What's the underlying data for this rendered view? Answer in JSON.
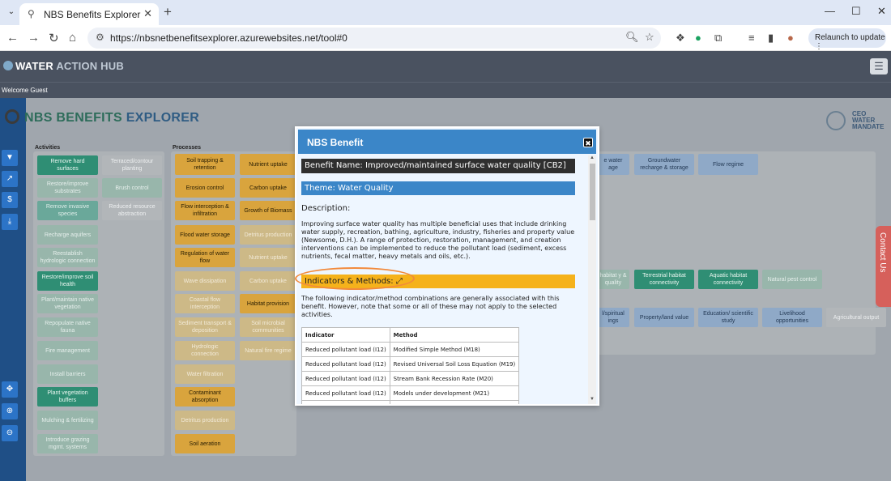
{
  "browser": {
    "tab_title": "NBS Benefits Explorer",
    "url": "https://nbsnetbenefitsexplorer.azurewebsites.net/tool#0",
    "relaunch_label": "Relaunch to update",
    "tab_close": "✕",
    "new_tab": "+",
    "minimize": "—",
    "maximize": "☐",
    "close": "✕"
  },
  "header": {
    "brand_primary": "WATER",
    "brand_secondary": "ACTION",
    "brand_tertiary": "HUB",
    "welcome": "Welcome Guest",
    "menu_icon": "☰"
  },
  "app": {
    "title_part1": "NBS BENEFITS",
    "title_part2": "EXPLORER",
    "ceo_line1": "CEO",
    "ceo_line2": "WATER",
    "ceo_line3": "MANDATE",
    "contact_label": "Contact Us"
  },
  "sidebar": {
    "icons": [
      "filter-icon",
      "chart-icon",
      "dollar-icon",
      "download-icon",
      "expand-icon",
      "zoom-in-icon",
      "zoom-out-icon"
    ]
  },
  "activities": {
    "label": "Activities",
    "items": [
      "Remove hard surfaces",
      "Terraced/contour planting",
      "Restore/improve substrates",
      "Brush control",
      "Remove invasive species",
      "Reduced resource abstraction",
      "Recharge aquifers",
      "Reestablish hydrologic connection",
      "Restore/improve soil health",
      "Plant/maintain native vegetation",
      "Repopulate native fauna",
      "Fire management",
      "Install barriers",
      "Plant vegetation buffers",
      "Mulching & fertilizing",
      "Introduce grazing mgmt. systems"
    ]
  },
  "processes": {
    "label": "Processes",
    "items": [
      "Soil trapping & retention",
      "Nutrient uptake",
      "Erosion control",
      "Carbon uptake",
      "Flow interception & infiltration",
      "Growth of Biomass",
      "Flood water storage",
      "Detritus production",
      "Regulation of water flow",
      "Nutrient uptake",
      "Wave dissipation",
      "Carbon uptake",
      "Coastal flow interception",
      "Habitat provision",
      "Sediment transport & deposition",
      "Soil microbial communities",
      "Hydrologic connection",
      "Natural fire regime",
      "Water filtration",
      "Contaminant absorption",
      "Detritus production",
      "Soil aeration"
    ]
  },
  "benefits": {
    "items": [
      "e water age",
      "Groundwater recharge & storage",
      "Flow regime",
      "habitat y & quality",
      "Terrestrial habitat connectivity",
      "Aquatic habitat connectivity",
      "Natural pest control",
      "l/spiritual ings",
      "Property/land value",
      "Education/ scientific study",
      "Livelihood opportunities",
      "Agricultural output"
    ]
  },
  "modal": {
    "title": "NBS Benefit",
    "close_icon": "✖",
    "benefit_name": "Benefit Name: Improved/maintained surface water quality [CB2]",
    "theme": "Theme: Water Quality",
    "description_heading": "Description:",
    "description": "Improving surface water quality has multiple beneficial uses that include drinking water supply, recreation, bathing, agriculture, industry, fisheries and property value (Newsome, D.H.). A range of protection, restoration, management, and creation interventions can be implemented to reduce the pollutant load (sediment, excess nutrients, fecal matter, heavy metals and oils, etc.).",
    "indicators_heading": "Indicators & Methods:",
    "expand_icon": "⤢",
    "combo_text": "The following indicator/method combinations are generally associated with this benefit. However, note that some or all of these may not apply to the selected activities.",
    "table": {
      "headers": [
        "Indicator",
        "Method"
      ],
      "rows": [
        [
          "Reduced pollutant load (I12)",
          "Modified Simple Method (M18)"
        ],
        [
          "Reduced pollutant load (I12)",
          "Revised Universal Soil Loss Equation (M19)"
        ],
        [
          "Reduced pollutant load (I12)",
          "Stream Bank Recession Rate (M20)"
        ],
        [
          "Reduced pollutant load (I12)",
          "Models under development (M21)"
        ]
      ]
    }
  }
}
